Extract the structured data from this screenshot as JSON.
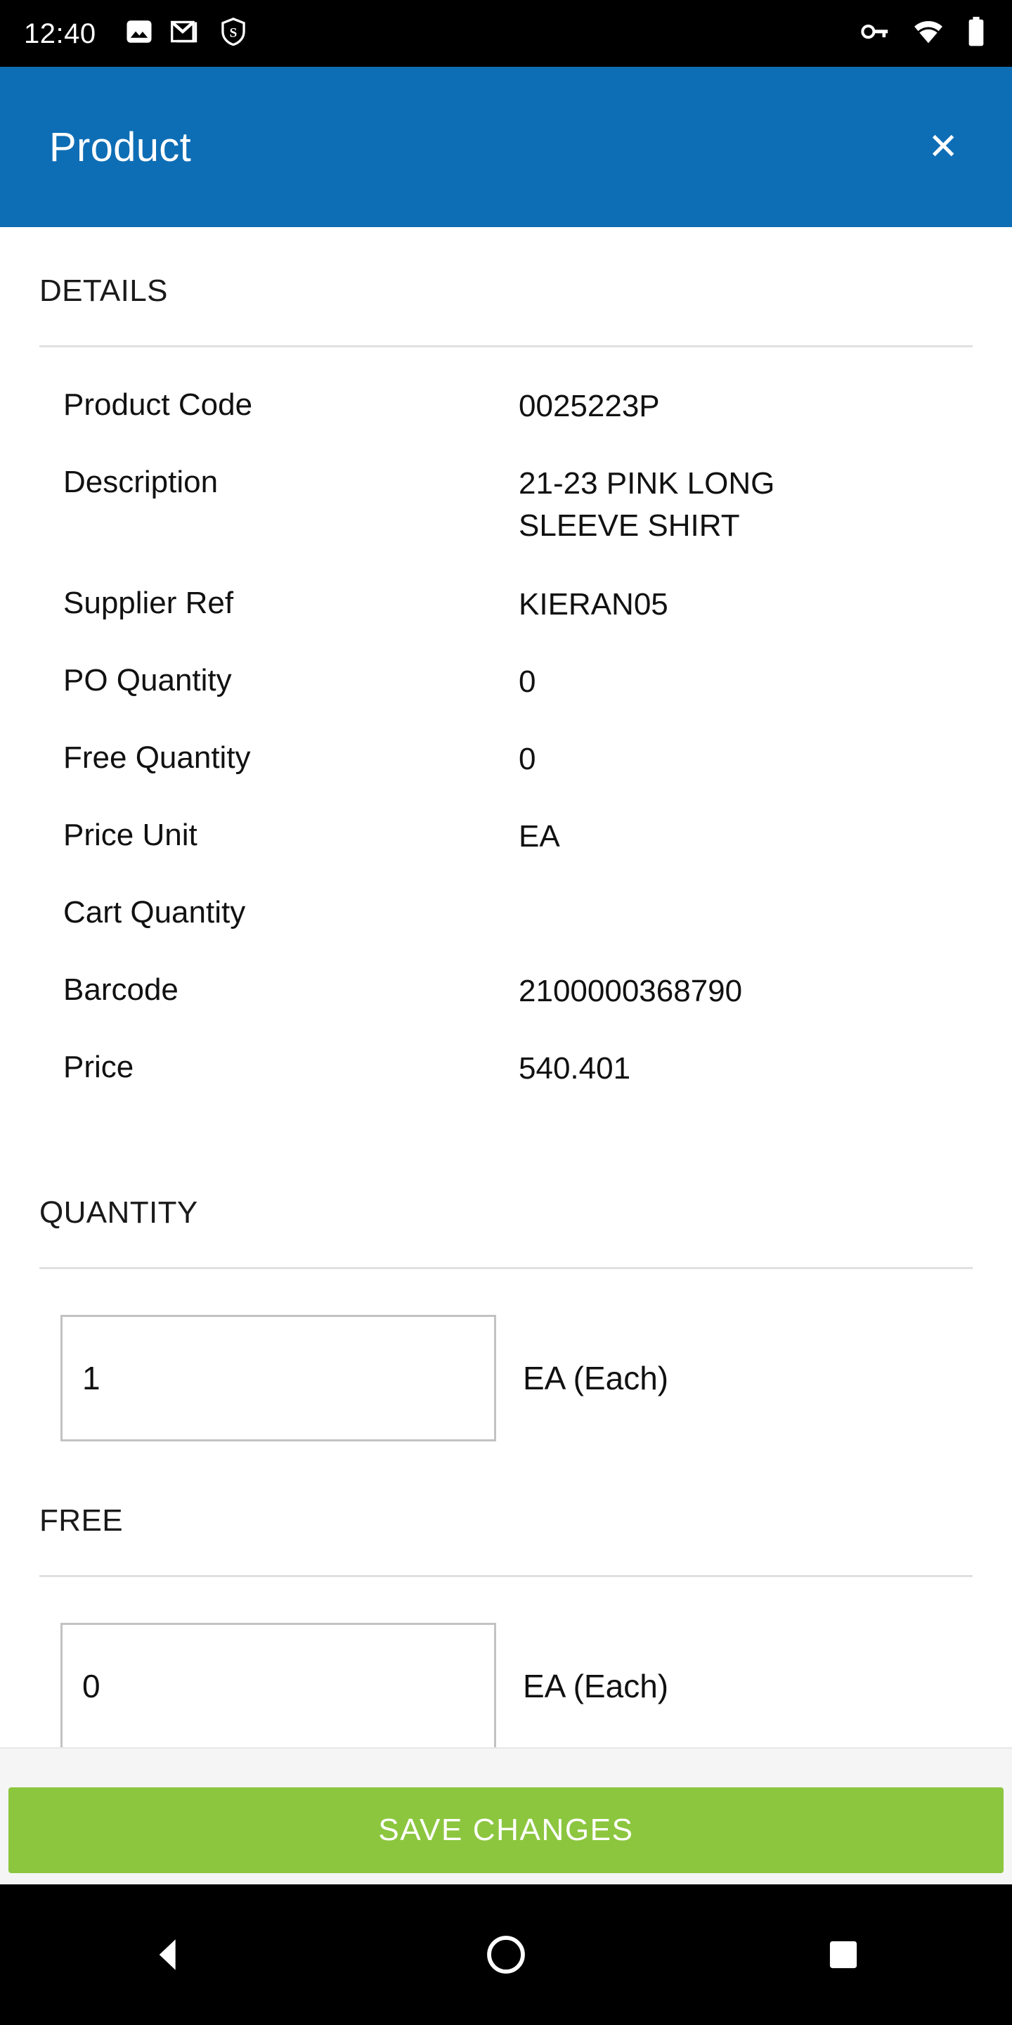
{
  "statusbar": {
    "time": "12:40",
    "notifications": [
      {
        "icon": "photo-icon"
      },
      {
        "icon": "gmail-icon"
      },
      {
        "icon": "shield-s-icon"
      }
    ],
    "system": [
      {
        "icon": "vpn-key-icon"
      },
      {
        "icon": "wifi-icon"
      },
      {
        "icon": "battery-full-icon"
      }
    ]
  },
  "appbar": {
    "title": "Product",
    "close_label": "✕"
  },
  "details": {
    "heading": "DETAILS",
    "rows": [
      {
        "label": "Product Code",
        "value": "0025223P"
      },
      {
        "label": "Description",
        "value": "21-23 PINK LONG\nSLEEVE SHIRT"
      },
      {
        "label": "Supplier Ref",
        "value": "KIERAN05"
      },
      {
        "label": "PO Quantity",
        "value": "0"
      },
      {
        "label": "Free Quantity",
        "value": "0"
      },
      {
        "label": "Price Unit",
        "value": "EA"
      },
      {
        "label": "Cart Quantity",
        "value": ""
      },
      {
        "label": "Barcode",
        "value": "2100000368790"
      },
      {
        "label": "Price",
        "value": "540.401"
      }
    ]
  },
  "quantity": {
    "heading": "QUANTITY",
    "value": "1",
    "unit": "EA (Each)"
  },
  "free": {
    "heading": "FREE",
    "value": "0",
    "unit": "EA (Each)"
  },
  "footer": {
    "save_label": "SAVE CHANGES"
  },
  "navbar": {
    "back": "back-nav-icon",
    "home": "home-nav-icon",
    "recents": "recents-nav-icon"
  },
  "colors": {
    "appbar_blue": "#0E6EB5",
    "save_green": "#8CC63F",
    "text": "#111111",
    "divider": "#e0e0e0",
    "footer_bg": "#f5f5f5"
  }
}
